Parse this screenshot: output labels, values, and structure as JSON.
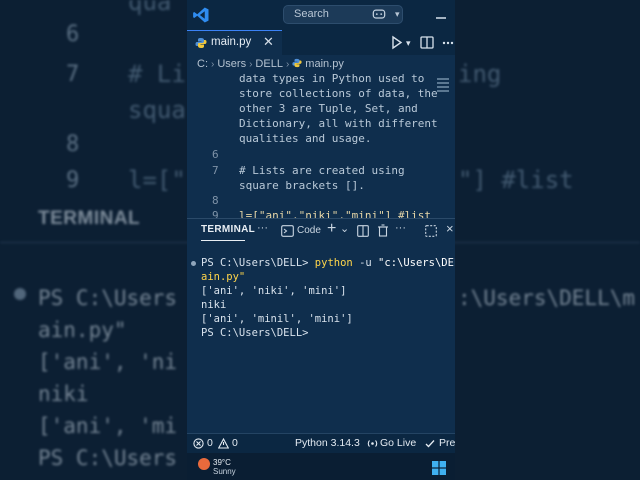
{
  "background": {
    "line_numbers": [
      "6",
      "7",
      "8",
      "9"
    ],
    "code_fragments": [
      "qua",
      "# Li",
      "squa",
      "l=[\"",
      "\"] #list",
      "ing"
    ],
    "terminal_tab": "TERMINAL",
    "terminal_lines": [
      "PS C:\\Users",
      "ain.py\"",
      "['ani', 'ni",
      "niki",
      "['ani', 'mi",
      "PS C:\\Users"
    ],
    "terminal_fragment_right": ":\\Users\\DELL\\m"
  },
  "titlebar": {
    "search_label": "Search",
    "icons": [
      "vscode-logo",
      "copilot-icon",
      "chevron-down-icon",
      "minimize-icon"
    ]
  },
  "tabs": {
    "active_tab": "main.py",
    "close_glyph": "✕",
    "editor_actions": [
      "run-icon",
      "chevron-down-icon",
      "split-editor-icon",
      "more-icon"
    ]
  },
  "breadcrumbs": [
    "C:",
    "Users",
    "DELL",
    "main.py"
  ],
  "editor": {
    "lines": [
      {
        "num": "",
        "text": "data types in Python used to"
      },
      {
        "num": "",
        "text": "store collections of data, the"
      },
      {
        "num": "",
        "text": "other 3 are Tuple, Set, and"
      },
      {
        "num": "",
        "text": "Dictionary, all with different"
      },
      {
        "num": "",
        "text": "qualities and usage."
      },
      {
        "num": "6",
        "text": ""
      },
      {
        "num": "7",
        "text": "# Lists are created using"
      },
      {
        "num": "",
        "text": "square brackets []."
      },
      {
        "num": "8",
        "text": ""
      },
      {
        "num": "9",
        "text": "l=[\"ani\",\"niki\",\"mini\"] #list"
      }
    ]
  },
  "panel": {
    "tab": "TERMINAL",
    "more": "···",
    "code_label": "Code",
    "plus": "+",
    "chevron": "⌄",
    "more_right": "···",
    "close": "×"
  },
  "terminal": {
    "prompt1": "PS C:\\Users\\DELL>",
    "cmd": "python",
    "flag": "-u",
    "path": "\"c:\\Users\\DELL\\m",
    "path_wrap": "ain.py\"",
    "out1": "['ani', 'niki', 'mini']",
    "out2": "niki",
    "out3": "['ani', 'minil', 'mini']",
    "prompt2": "PS C:\\Users\\DELL>"
  },
  "statusbar": {
    "errors": "0",
    "warnings": "0",
    "python": "Python 3.14.3",
    "golive": "Go Live",
    "prettier": "Pre"
  },
  "taskbar": {
    "temperature": "39°C",
    "weather": "Sunny"
  }
}
